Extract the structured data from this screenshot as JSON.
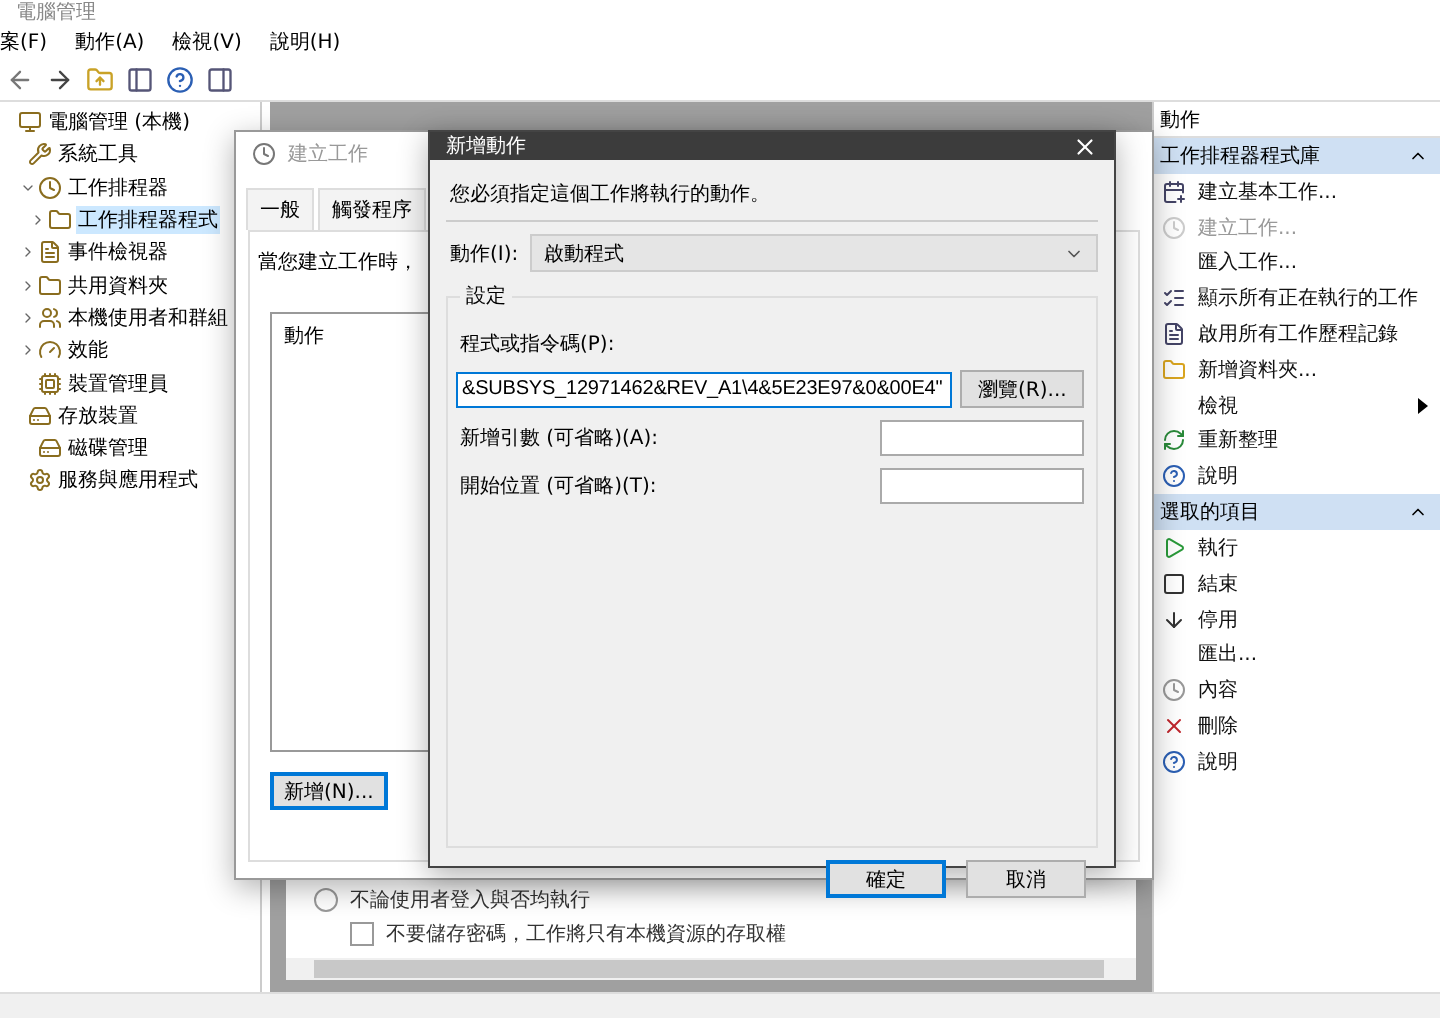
{
  "window": {
    "title": "電腦管理"
  },
  "menu": [
    {
      "label": "案(F)"
    },
    {
      "label": "動作(A)"
    },
    {
      "label": "檢視(V)"
    },
    {
      "label": "說明(H)"
    }
  ],
  "tree": [
    {
      "label": "電腦管理 (本機)",
      "selected": false,
      "children": [
        {
          "label": "系統工具",
          "selected": false,
          "children": [
            {
              "label": "工作排程器",
              "selected": false,
              "expanded": true,
              "children": [
                {
                  "label": "工作排程器程式",
                  "selected": true,
                  "expanded": false
                }
              ]
            },
            {
              "label": "事件檢視器",
              "selected": false,
              "expanded": false
            },
            {
              "label": "共用資料夾",
              "selected": false,
              "expanded": false
            },
            {
              "label": "本機使用者和群組",
              "selected": false,
              "expanded": false
            },
            {
              "label": "效能",
              "selected": false,
              "expanded": false
            },
            {
              "label": "裝置管理員",
              "selected": false
            }
          ]
        },
        {
          "label": "存放裝置",
          "selected": false,
          "children": [
            {
              "label": "磁碟管理",
              "selected": false
            }
          ]
        },
        {
          "label": "服務與應用程式",
          "selected": false
        }
      ]
    }
  ],
  "actions_pane": {
    "title": "動作",
    "sections": [
      {
        "title": "工作排程器程式庫",
        "expanded": true,
        "items": [
          {
            "label": "建立基本工作...",
            "kind": "command",
            "disabled": false
          },
          {
            "label": "建立工作...",
            "kind": "command",
            "disabled": true
          },
          {
            "label": "匯入工作...",
            "kind": "command",
            "disabled": false
          },
          {
            "label": "顯示所有正在執行的工作",
            "kind": "command",
            "disabled": false
          },
          {
            "label": "啟用所有工作歷程記錄",
            "kind": "command",
            "disabled": false
          },
          {
            "label": "新增資料夾...",
            "kind": "command",
            "disabled": false
          },
          {
            "label": "檢視",
            "kind": "submenu",
            "disabled": false
          },
          {
            "label": "重新整理",
            "kind": "command",
            "disabled": false
          },
          {
            "label": "說明",
            "kind": "command",
            "disabled": false
          }
        ]
      },
      {
        "title": "選取的項目",
        "expanded": true,
        "items": [
          {
            "label": "執行",
            "kind": "command",
            "disabled": false
          },
          {
            "label": "結束",
            "kind": "command",
            "disabled": false
          },
          {
            "label": "停用",
            "kind": "command",
            "disabled": false
          },
          {
            "label": "匯出...",
            "kind": "command",
            "disabled": false
          },
          {
            "label": "內容",
            "kind": "command",
            "disabled": false
          },
          {
            "label": "刪除",
            "kind": "command",
            "disabled": false
          },
          {
            "label": "說明",
            "kind": "command",
            "disabled": false
          }
        ]
      }
    ]
  },
  "lower_pane": {
    "options": [
      {
        "kind": "radio",
        "label": "不論使用者登入與否均執行",
        "checked": false
      },
      {
        "kind": "checkbox",
        "label": "不要儲存密碼，工作將只有本機資源的存取權",
        "checked": false
      }
    ]
  },
  "create_task": {
    "title": "建立工作",
    "tabs": [
      {
        "label": "一般",
        "selected": false
      },
      {
        "label": "觸發程序",
        "selected": false
      }
    ],
    "intro": "當您建立工作時，",
    "list_header": "動作",
    "new_button": "新增(N)..."
  },
  "new_action": {
    "title": "新增動作",
    "instruction": "您必須指定這個工作將執行的動作。",
    "action_label": "動作(I):",
    "action_value": "啟動程式",
    "group": "設定",
    "program_label": "程式或指令碼(P):",
    "program_value": "&SUBSYS_12971462&REV_A1\\4&5E23E97&0&00E4\"",
    "browse": "瀏覽(R)...",
    "args_label": "新增引數 (可省略)(A):",
    "start_label": "開始位置 (可省略)(T):",
    "ok": "確定",
    "cancel": "取消"
  }
}
